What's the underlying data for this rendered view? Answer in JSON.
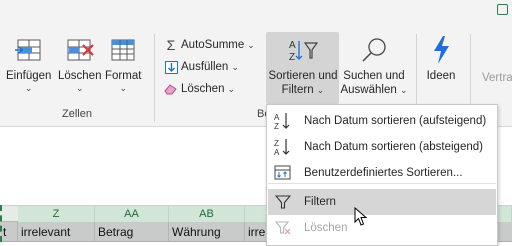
{
  "ribbon": {
    "cells_group": {
      "label": "Zellen",
      "insert": "Einfügen",
      "delete": "Löschen",
      "format": "Format"
    },
    "editing": {
      "autosum": "AutoSumme",
      "fill": "Ausfüllen",
      "clear": "Löschen",
      "sort_filter_line1": "Sortieren und",
      "sort_filter_line2": "Filtern",
      "find_select_line1": "Suchen und",
      "find_select_line2": "Auswählen",
      "group_label_partial": "Be"
    },
    "ideas": "Ideen",
    "partial_right": "Vertra",
    "chevron": "⌄"
  },
  "menu": {
    "items": [
      {
        "label": "Nach Datum sortieren (aufsteigend)",
        "icon": "sort-ascending-icon"
      },
      {
        "label": "Nach Datum sortieren (absteigend)",
        "icon": "sort-descending-icon"
      },
      {
        "label": "Benutzerdefiniertes Sortieren...",
        "icon": "custom-sort-icon"
      },
      {
        "label": "Filtern",
        "icon": "filter-icon",
        "hovered": true
      },
      {
        "label": "Löschen",
        "icon": "clear-filter-icon",
        "disabled": true
      }
    ]
  },
  "sheet": {
    "columns": [
      "Z",
      "AA",
      "AB"
    ],
    "row1": [
      "irrelevant",
      "Betrag",
      "Währung",
      "irre"
    ],
    "left_partial": "t"
  },
  "colors": {
    "accent_green": "#2e7d46",
    "ribbon_bg": "#f3f3f3",
    "ideas_blue": "#1e6fd9",
    "delete_red": "#d13438"
  }
}
